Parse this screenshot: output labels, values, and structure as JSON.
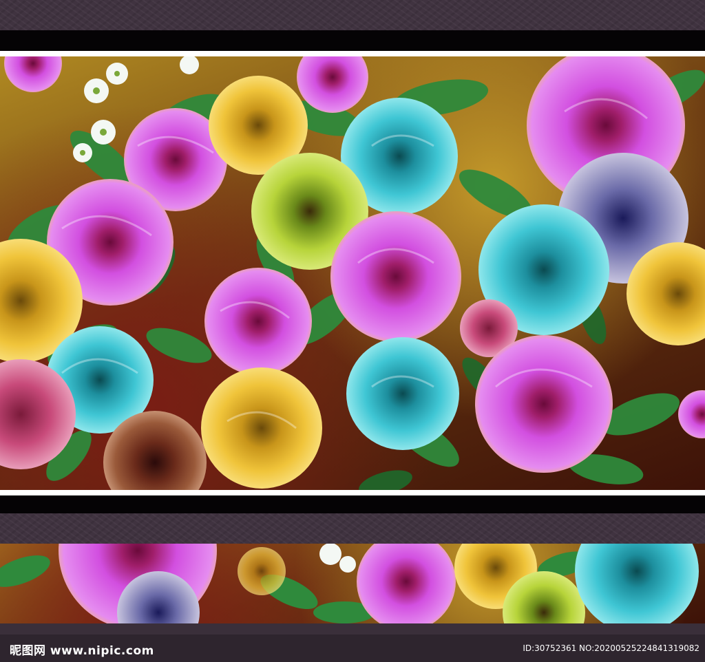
{
  "watermark": {
    "logo_text": "昵图网 www.nipic.com",
    "image_id_text": "ID:30752361 NO:20200525224841319082"
  },
  "palette": {
    "band": "#403340",
    "bar": "#050305",
    "rule": "#ffffff",
    "magenta_rose": "#d24fe0",
    "teal_rose": "#3fc6d4",
    "yellow_rose": "#f0c43a",
    "lime_rose": "#b7d43a",
    "brown_rose": "#8a4a2a",
    "leaf": "#2f8a3c"
  }
}
